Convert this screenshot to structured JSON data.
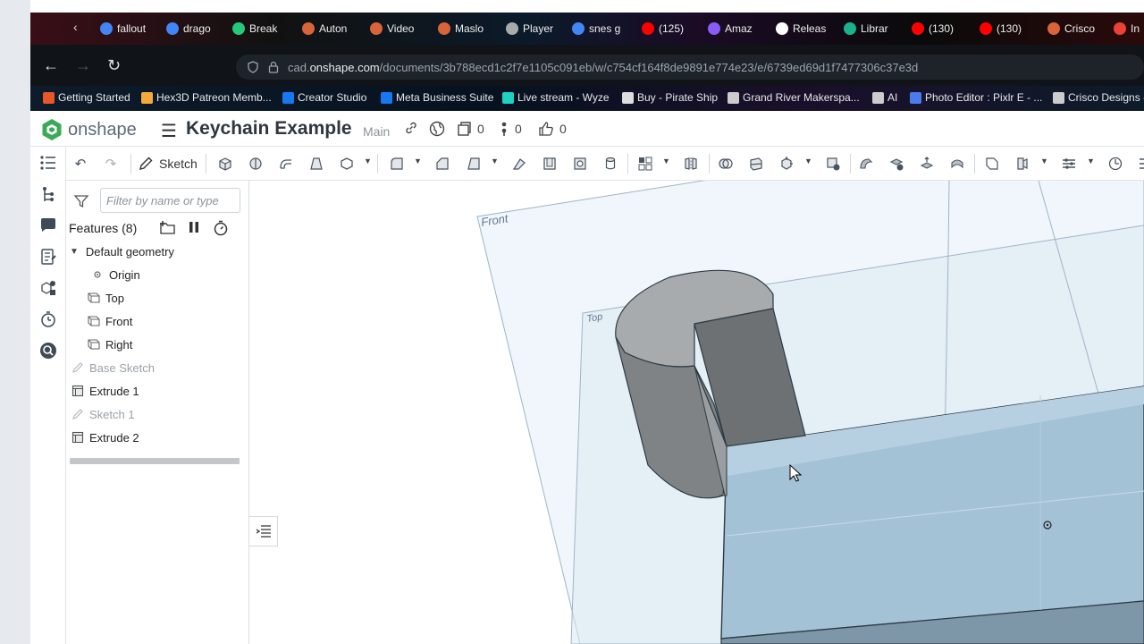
{
  "browser": {
    "tabs": [
      {
        "label": "fallout",
        "color": "#4285f4"
      },
      {
        "label": "drago",
        "color": "#4285f4"
      },
      {
        "label": "Break",
        "color": "#28c87a"
      },
      {
        "label": "Auton",
        "color": "#d9643a"
      },
      {
        "label": "Video",
        "color": "#d9643a"
      },
      {
        "label": "Maslo",
        "color": "#d9643a"
      },
      {
        "label": "Player",
        "color": "#aaaaaa"
      },
      {
        "label": "snes g",
        "color": "#4285f4"
      },
      {
        "label": "(125)",
        "color": "#ff0000"
      },
      {
        "label": "Amaz",
        "color": "#8a5cf6"
      },
      {
        "label": "Releas",
        "color": "#ffffff"
      },
      {
        "label": "Librar",
        "color": "#19b28c"
      },
      {
        "label": "(130)",
        "color": "#ff0000"
      },
      {
        "label": "(130)",
        "color": "#ff0000"
      },
      {
        "label": "Crisco",
        "color": "#d9643a"
      },
      {
        "label": "In",
        "color": "#ea4335"
      }
    ],
    "url_prefix": "cad.",
    "url_domain": "onshape.com",
    "url_path": "/documents/3b788ecd1c2f7e1105c091eb/w/c754cf164f8de9891e774e23/e/6739ed69d1f7477306c37e3d",
    "bookmarks": [
      {
        "label": "Getting Started",
        "color": "#e8562a"
      },
      {
        "label": "Hex3D Patreon Memb...",
        "color": "#f4a93a"
      },
      {
        "label": "Creator Studio",
        "color": "#1877f2"
      },
      {
        "label": "Meta Business Suite",
        "color": "#1877f2"
      },
      {
        "label": "Live stream - Wyze",
        "color": "#1fd1c1"
      },
      {
        "label": "Buy - Pirate Ship",
        "color": "#dddddd"
      },
      {
        "label": "Grand River Makerspa...",
        "color": "#cccccc"
      },
      {
        "label": "AI",
        "color": "#cccccc"
      },
      {
        "label": "Photo Editor : Pixlr E - ...",
        "color": "#4b7bec"
      },
      {
        "label": "Crisco Designs -",
        "color": "#cccccc"
      }
    ]
  },
  "onshape": {
    "logo_text": "onshape",
    "doc_title": "Keychain Example",
    "branch": "Main",
    "versions_count": "0",
    "branches_count": "0",
    "likes_count": "0",
    "accent": "#3aaa56"
  },
  "toolbar": {
    "sketch_label": "Sketch"
  },
  "features": {
    "filter_placeholder": "Filter by name or type",
    "title": "Features (8)",
    "default_geometry": "Default geometry",
    "items": [
      {
        "label": "Origin",
        "type": "origin",
        "indent": true,
        "dim": false
      },
      {
        "label": "Top",
        "type": "plane",
        "indent": true,
        "dim": false
      },
      {
        "label": "Front",
        "type": "plane",
        "indent": true,
        "dim": false
      },
      {
        "label": "Right",
        "type": "plane",
        "indent": true,
        "dim": false
      },
      {
        "label": "Base Sketch",
        "type": "sketch",
        "indent": false,
        "dim": true
      },
      {
        "label": "Extrude 1",
        "type": "extrude",
        "indent": false,
        "dim": false
      },
      {
        "label": "Sketch 1",
        "type": "sketch",
        "indent": false,
        "dim": true
      },
      {
        "label": "Extrude 2",
        "type": "extrude",
        "indent": false,
        "dim": false
      }
    ]
  },
  "viewport": {
    "plane_front_label": "Front",
    "plane_top_label": "Top",
    "part_color": "#a9c6d8",
    "boss_color": "#8a8d90"
  }
}
